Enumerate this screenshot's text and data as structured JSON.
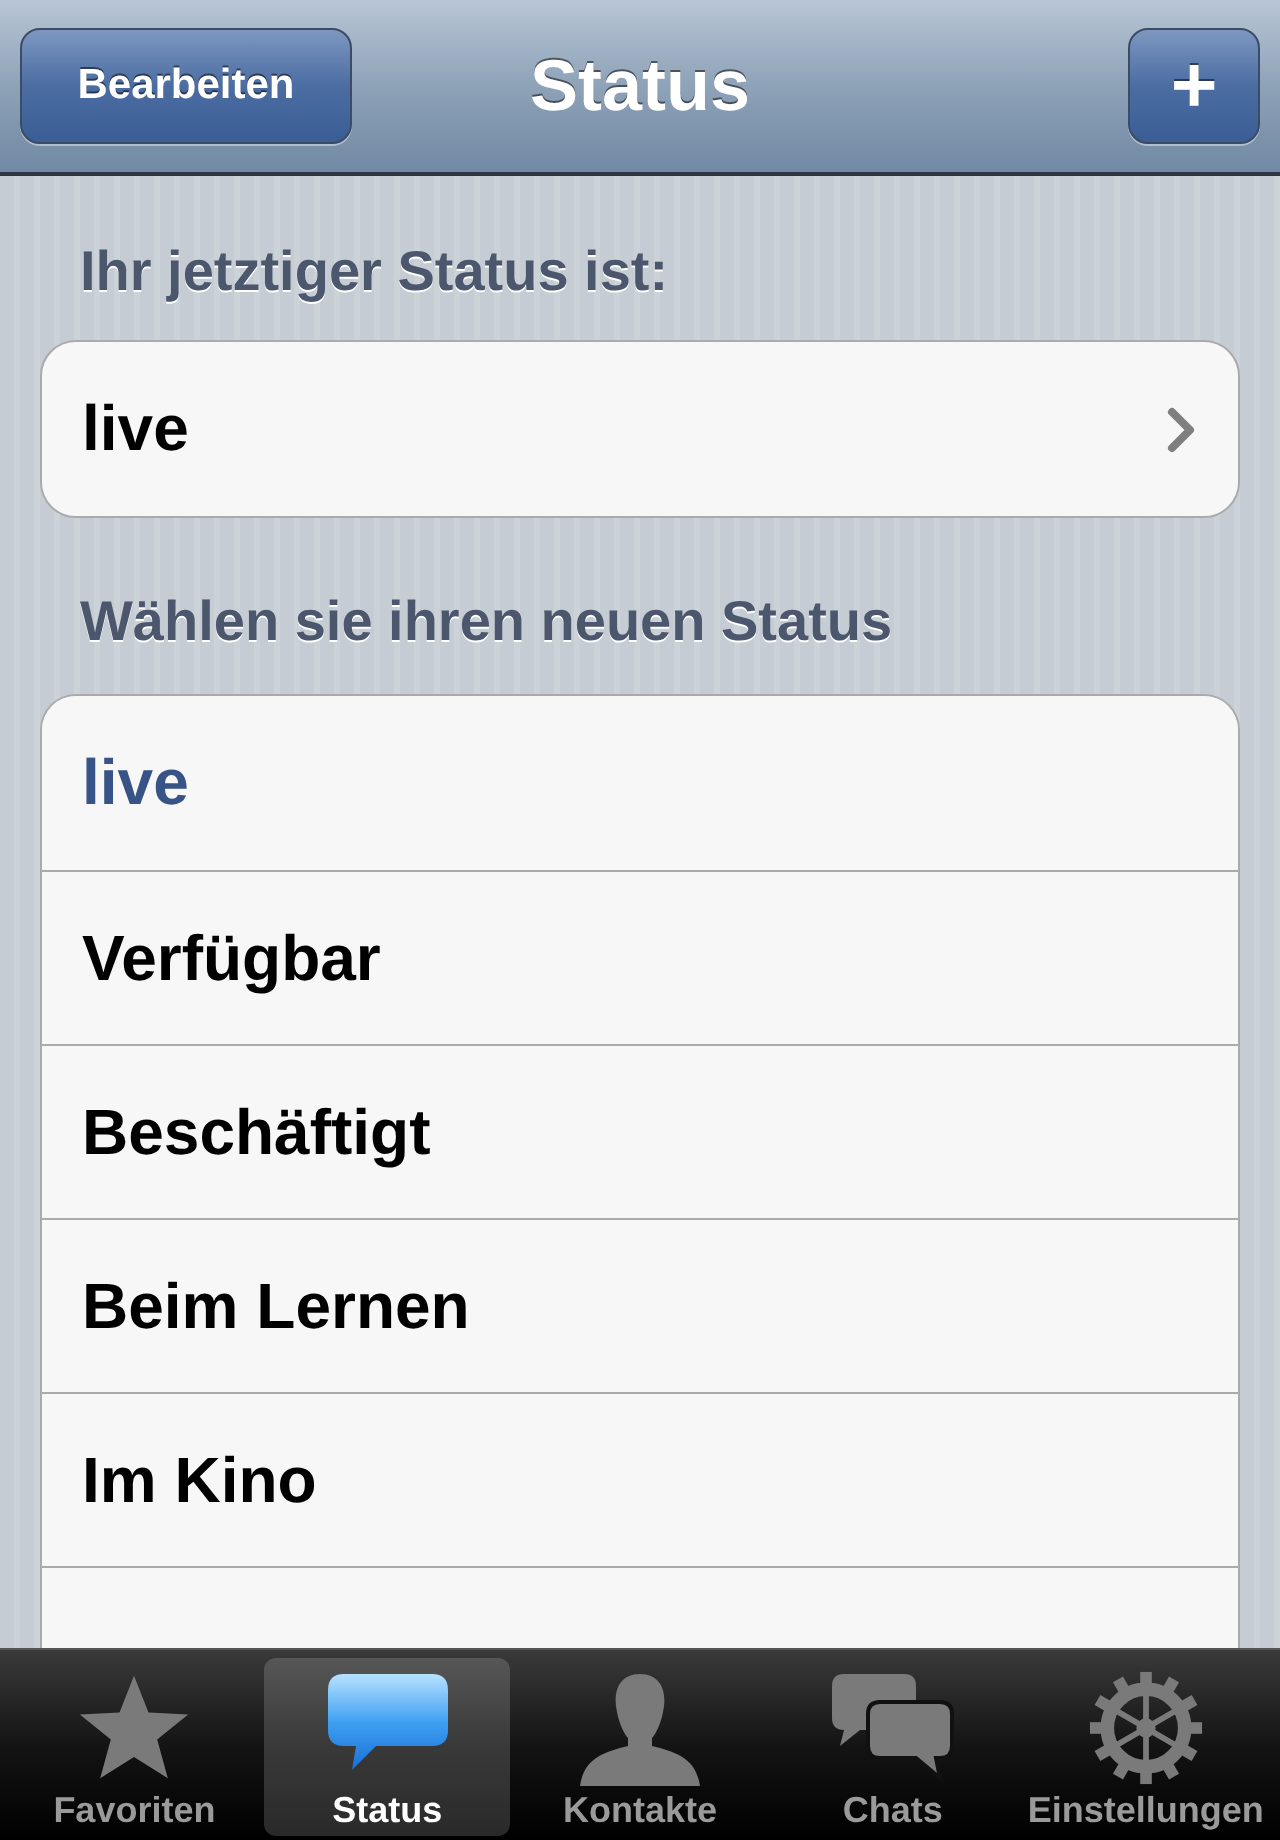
{
  "nav_bar": {
    "edit_button": "Bearbeiten",
    "title": "Status",
    "add_button": "+"
  },
  "current_status": {
    "header": "Ihr jetztiger Status ist:",
    "value": "live"
  },
  "new_status": {
    "header": "Wählen sie ihren neuen Status",
    "options": [
      {
        "label": "live",
        "selected": true
      },
      {
        "label": "Verfügbar",
        "selected": false
      },
      {
        "label": "Beschäftigt",
        "selected": false
      },
      {
        "label": "Beim Lernen",
        "selected": false
      },
      {
        "label": "Im Kino",
        "selected": false
      }
    ]
  },
  "tab_bar": [
    {
      "label": "Favoriten",
      "kind": "star",
      "selected": false
    },
    {
      "label": "Status",
      "kind": "bubble",
      "selected": true
    },
    {
      "label": "Kontakte",
      "kind": "person",
      "selected": false
    },
    {
      "label": "Chats",
      "kind": "bubbles",
      "selected": false
    },
    {
      "label": "Einstellungen",
      "kind": "gear",
      "selected": false
    }
  ]
}
